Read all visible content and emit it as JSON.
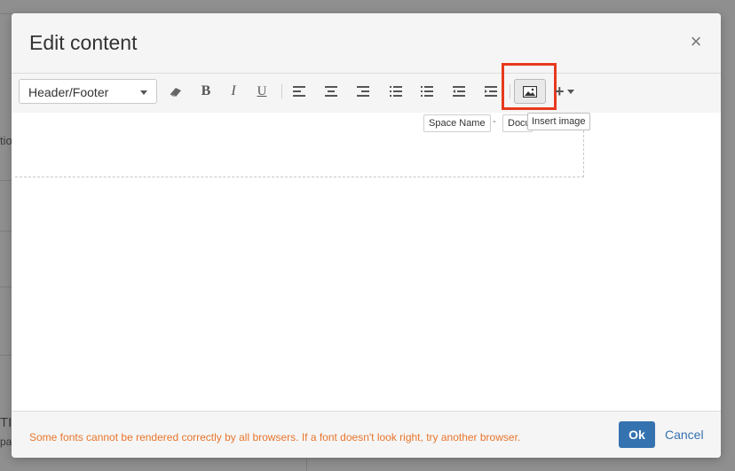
{
  "background": {
    "text_left_1": "tio",
    "text_left_2": "TI",
    "text_left_3": "pa"
  },
  "dialog": {
    "title": "Edit content",
    "close_glyph": "×"
  },
  "toolbar": {
    "style_select_value": "Header/Footer",
    "buttons": [
      {
        "name": "eraser-icon",
        "glyph": "⌫"
      },
      {
        "name": "bold-icon",
        "glyph": "B"
      },
      {
        "name": "italic-icon",
        "glyph": "I"
      },
      {
        "name": "underline-icon",
        "glyph": "U"
      },
      {
        "name": "align-left-icon",
        "glyph": "≡"
      },
      {
        "name": "align-center-icon",
        "glyph": "≡"
      },
      {
        "name": "align-right-icon",
        "glyph": "≡"
      },
      {
        "name": "bullet-list-icon",
        "glyph": "☰"
      },
      {
        "name": "numbered-list-icon",
        "glyph": "☰"
      },
      {
        "name": "outdent-icon",
        "glyph": "⇤"
      },
      {
        "name": "indent-icon",
        "glyph": "⇥"
      }
    ],
    "insert_image_icon": "image-icon",
    "plus_glyph": "+",
    "highlight_color": "#e8391d"
  },
  "editor": {
    "chip_space_name": "Space Name",
    "chip_separator": "-",
    "chip_document": "Docu",
    "tooltip": "Insert image"
  },
  "footer": {
    "warning": "Some fonts cannot be rendered correctly by all browsers. If a font doesn't look right, try another browser.",
    "ok_label": "Ok",
    "cancel_label": "Cancel",
    "accent_color": "#3572b0",
    "warning_color": "#e8762d"
  }
}
